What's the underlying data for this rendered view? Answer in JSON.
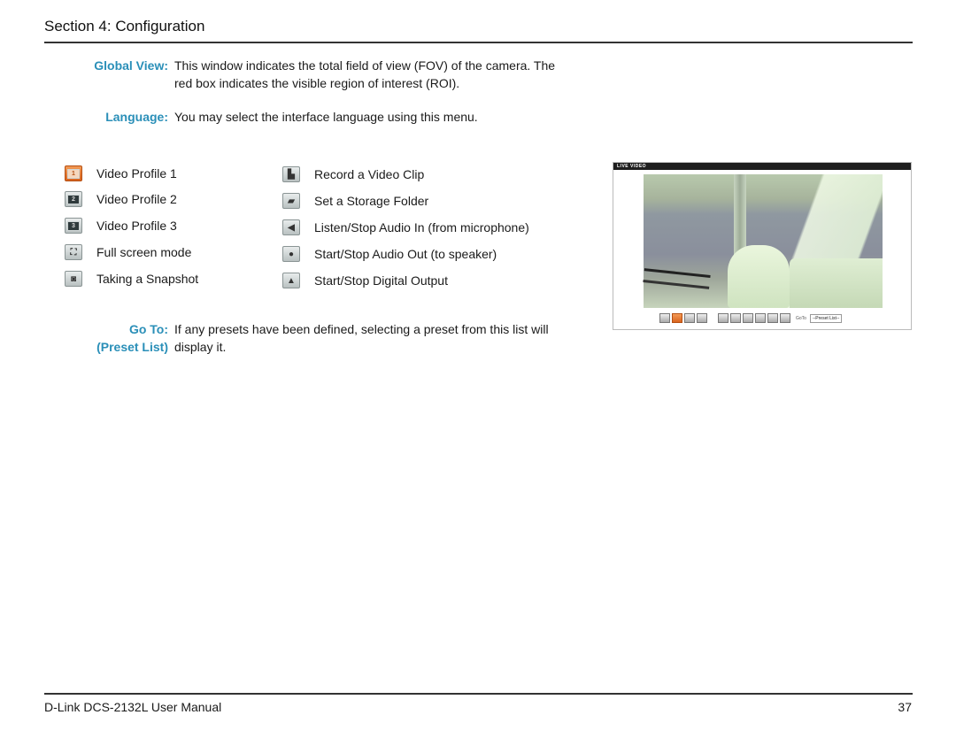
{
  "section_title": "Section 4: Configuration",
  "definitions": [
    {
      "term": "Global View:",
      "desc_lines": [
        "This window indicates the total field of view (FOV) of the camera. The",
        "red box indicates the visible region of interest (ROI)."
      ]
    },
    {
      "term": "Language:",
      "desc_lines": [
        "You may select the interface language using this menu."
      ]
    },
    {
      "term_lines": [
        "Go To:",
        "(Preset List)"
      ],
      "desc_lines": [
        "If any presets have been defined, selecting a preset from this list will",
        "display it."
      ]
    }
  ],
  "legend_left": [
    {
      "icon": "video-profile-1-icon",
      "glyph": "1",
      "label": "Video Profile 1"
    },
    {
      "icon": "video-profile-2-icon",
      "glyph": "2",
      "label": "Video Profile 2"
    },
    {
      "icon": "video-profile-3-icon",
      "glyph": "3",
      "label": "Video Profile 3"
    },
    {
      "icon": "fullscreen-icon",
      "glyph": "⛶",
      "label": "Full screen mode"
    },
    {
      "icon": "snapshot-icon",
      "glyph": "◙",
      "label": "Taking a Snapshot"
    }
  ],
  "legend_right": [
    {
      "icon": "record-video-icon",
      "glyph": "▙",
      "label": "Record a Video Clip"
    },
    {
      "icon": "storage-folder-icon",
      "glyph": "▰",
      "label": "Set a Storage Folder"
    },
    {
      "icon": "speaker-icon",
      "glyph": "◀",
      "label": "Listen/Stop Audio In (from microphone)"
    },
    {
      "icon": "microphone-icon",
      "glyph": "●",
      "label": "Start/Stop Audio Out (to speaker)"
    },
    {
      "icon": "digital-output-icon",
      "glyph": "▲",
      "label": "Start/Stop Digital Output"
    }
  ],
  "camera_panel": {
    "header": "LIVE VIDEO",
    "goto_label": "GoTo",
    "preset_value": "--Preset List--",
    "active_profile": 2
  },
  "footer": {
    "manual": "D-Link DCS-2132L User Manual",
    "page": "37"
  }
}
